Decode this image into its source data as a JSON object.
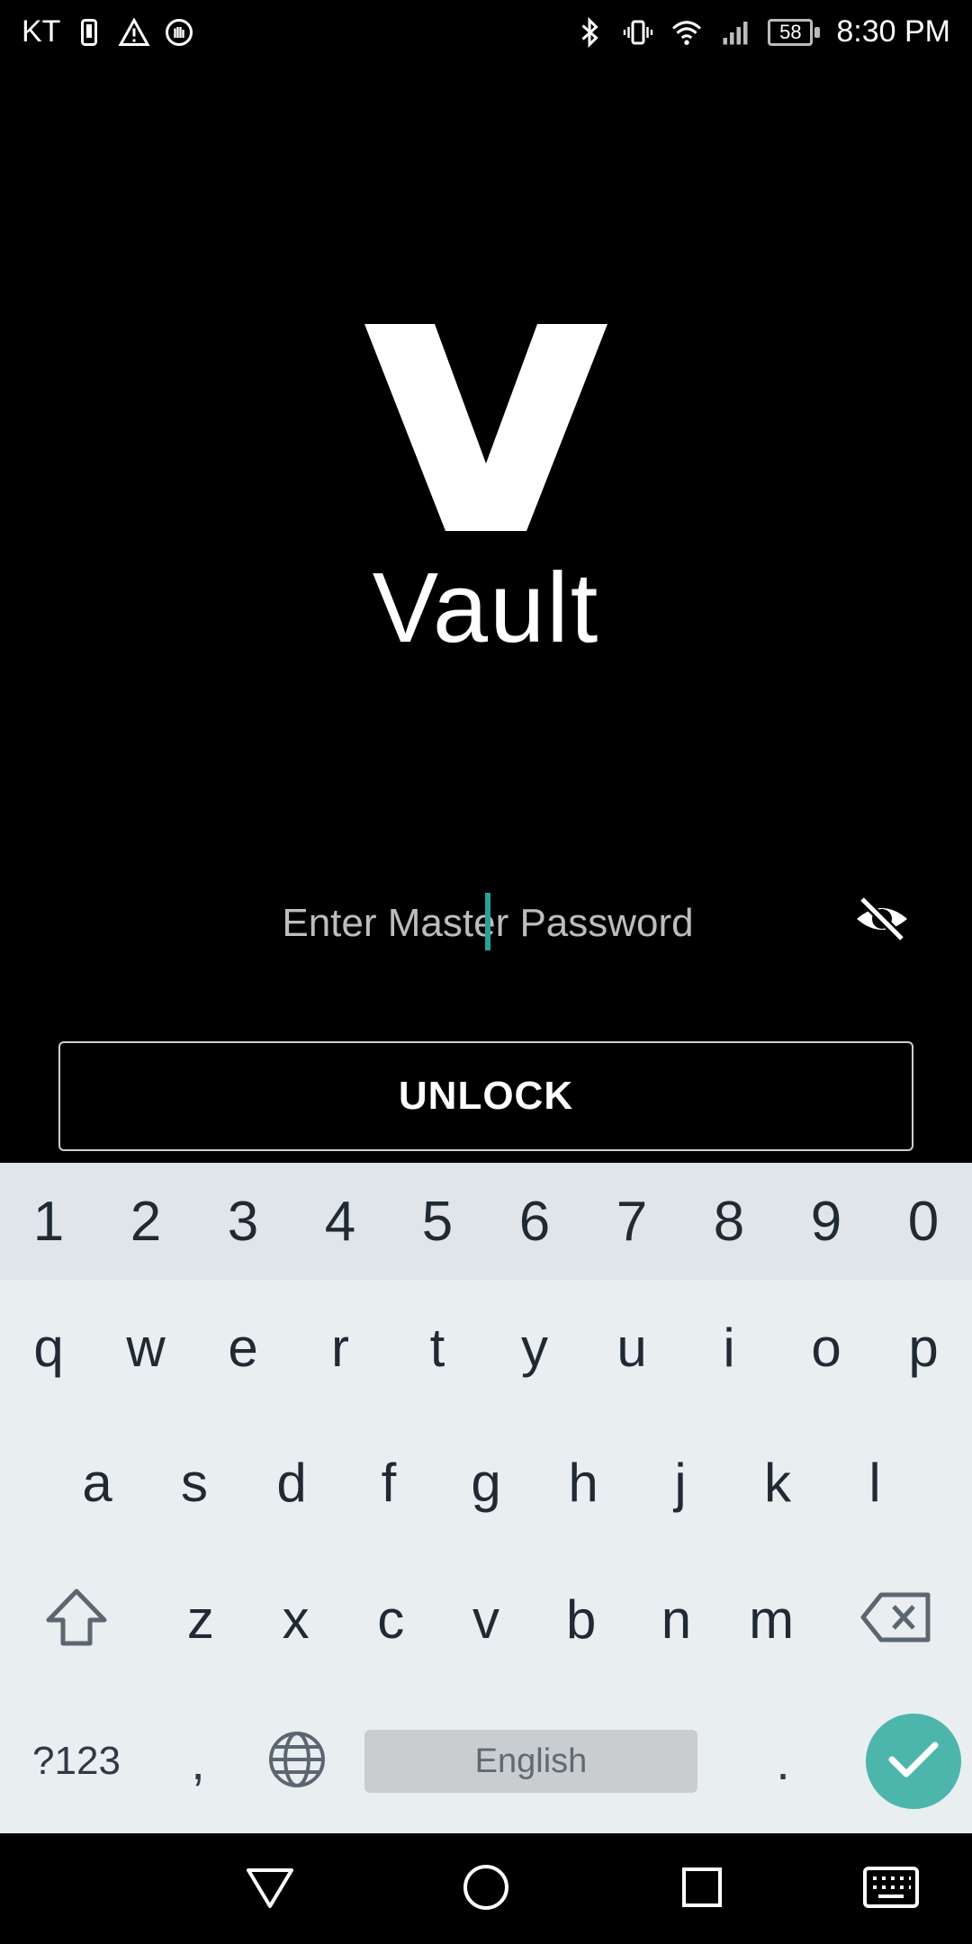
{
  "status_bar": {
    "carrier": "KT",
    "battery_level": "58",
    "time": "8:30 PM",
    "icons_left": [
      "phone-icon",
      "warning-icon",
      "hand-icon"
    ],
    "icons_right": [
      "bluetooth-icon",
      "vibrate-icon",
      "wifi-icon",
      "signal-icon",
      "battery-icon"
    ]
  },
  "app": {
    "logo_letter": "V",
    "name": "Vault"
  },
  "password_field": {
    "placeholder": "Enter Master Password",
    "value": "",
    "visibility_icon": "eye-off-icon"
  },
  "unlock_button": {
    "label": "UNLOCK"
  },
  "keyboard": {
    "number_row": [
      "1",
      "2",
      "3",
      "4",
      "5",
      "6",
      "7",
      "8",
      "9",
      "0"
    ],
    "row1": [
      "q",
      "w",
      "e",
      "r",
      "t",
      "y",
      "u",
      "i",
      "o",
      "p"
    ],
    "row2": [
      "a",
      "s",
      "d",
      "f",
      "g",
      "h",
      "j",
      "k",
      "l"
    ],
    "row3": [
      "z",
      "x",
      "c",
      "v",
      "b",
      "n",
      "m"
    ],
    "symbols_label": "?123",
    "comma_label": ",",
    "space_label": "English",
    "period_label": ".",
    "accent_color": "#4db6ac"
  },
  "nav_bar": {
    "buttons": [
      "back-icon",
      "home-icon",
      "recents-icon",
      "keyboard-icon"
    ]
  },
  "colors": {
    "background": "#000000",
    "caret": "#2aa198",
    "keyboard_bg": "#e9eef1",
    "number_row_bg": "#dfe5e9"
  }
}
